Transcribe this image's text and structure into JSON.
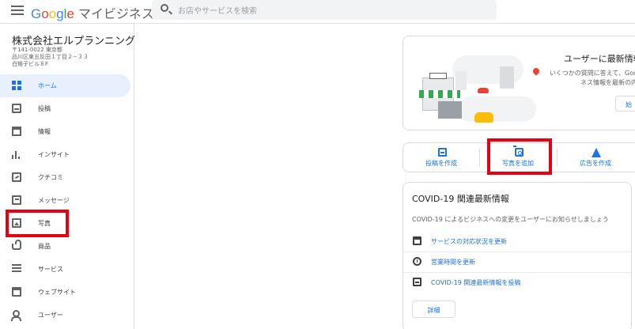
{
  "header": {
    "brand_letters": [
      "G",
      "o",
      "o",
      "g",
      "l",
      "e"
    ],
    "brand_suffix": "マイビジネス",
    "search_placeholder": "お店やサービスを検索"
  },
  "business": {
    "name": "株式会社エルプランニング",
    "address_lines": [
      "〒141-0022 東京都",
      "品川区東五反田１丁目２−３３",
      "白雉子ビル８F"
    ]
  },
  "sidebar": {
    "items": [
      {
        "label": "ホーム",
        "icon": "home-grid-icon",
        "active": true
      },
      {
        "label": "投稿",
        "icon": "post-icon"
      },
      {
        "label": "情報",
        "icon": "store-icon"
      },
      {
        "label": "インサイト",
        "icon": "bar-chart-icon"
      },
      {
        "label": "クチコミ",
        "icon": "review-icon"
      },
      {
        "label": "メッセージ",
        "icon": "message-icon"
      },
      {
        "label": "写真",
        "icon": "photo-icon"
      },
      {
        "label": "商品",
        "icon": "basket-icon"
      },
      {
        "label": "サービス",
        "icon": "list-icon"
      },
      {
        "label": "ウェブサイト",
        "icon": "website-icon"
      },
      {
        "label": "ユーザー",
        "icon": "add-user-icon"
      }
    ]
  },
  "banner": {
    "title": "ユーザーに最新情報",
    "text_lines": [
      "いくつかの質問に答えて、Goo",
      "ネス情報を最新の内"
    ],
    "button_label": "始"
  },
  "actions": [
    {
      "label": "投稿を作成",
      "icon": "post-icon"
    },
    {
      "label": "写真を追加",
      "icon": "camera-icon"
    },
    {
      "label": "広告を作成",
      "icon": "ads-icon"
    }
  ],
  "covid": {
    "title": "COVID-19 関連最新情報",
    "description": "COVID-19 によるビジネスへの変更をユーザーにお知らせしましょう",
    "links": [
      {
        "label": "サービスの対応状況を更新",
        "icon": "calendar-icon"
      },
      {
        "label": "営業時間を更新",
        "icon": "clock-icon"
      },
      {
        "label": "COVID-19 関連最新情報を投稿",
        "icon": "post-icon"
      }
    ],
    "button_label": "詳細"
  },
  "colors": {
    "accent": "#1a73e8",
    "highlight_box": "#e60012",
    "active_nav_bg": "#e8f0fe"
  }
}
